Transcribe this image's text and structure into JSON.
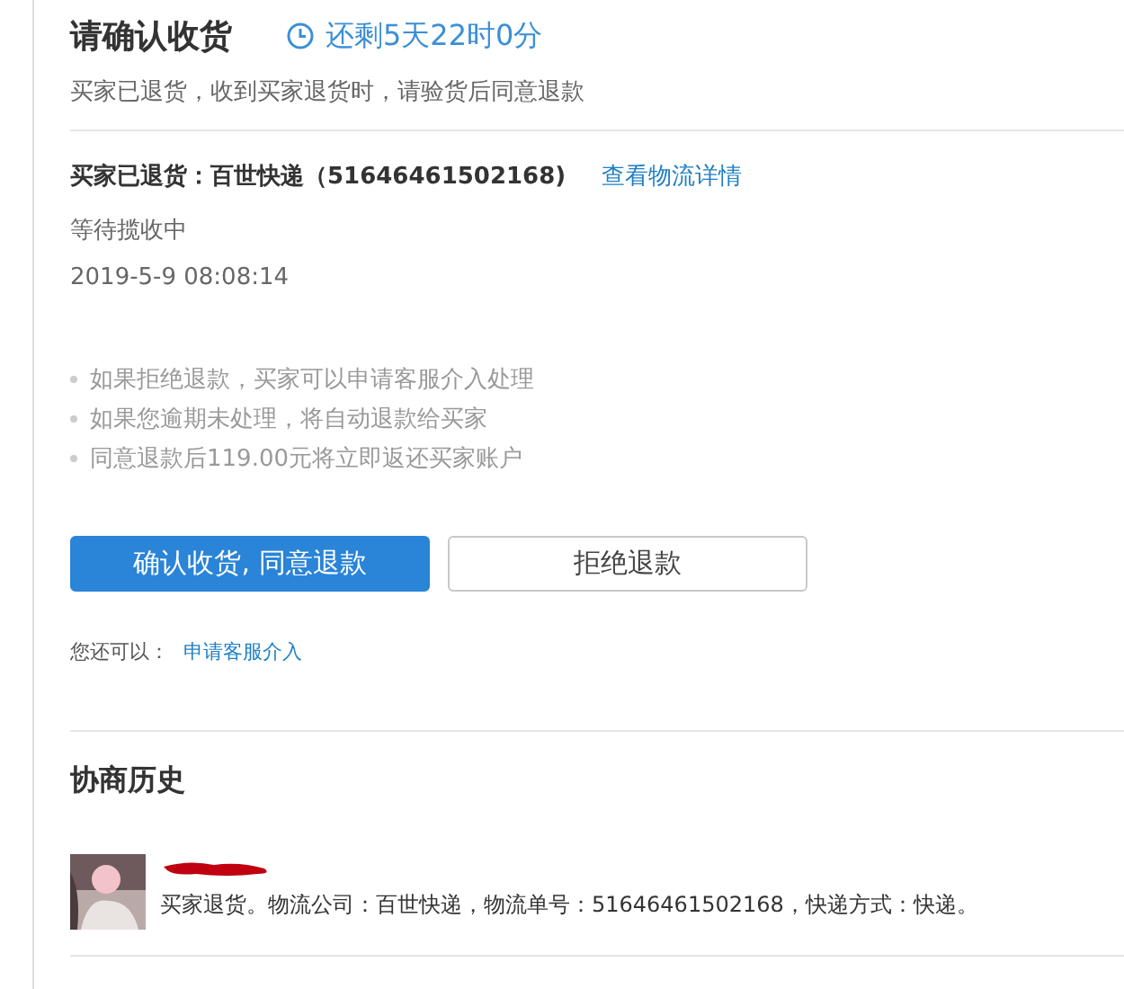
{
  "header": {
    "title": "请确认收货",
    "countdown": "还剩5天22时0分",
    "subtitle": "买家已退货，收到买家退货时，请验货后同意退款"
  },
  "shipment": {
    "label": "买家已退货：百世快递（51646461502168)",
    "link": "查看物流详情",
    "status": "等待揽收中",
    "time": "2019-5-9 08:08:14"
  },
  "notes": [
    "如果拒绝退款，买家可以申请客服介入处理",
    "如果您逾期未处理，将自动退款给买家",
    "同意退款后119.00元将立即返还买家账户"
  ],
  "buttons": [
    {
      "label": "确认收货, 同意退款",
      "kind": "primary"
    },
    {
      "label": "拒绝退款",
      "kind": "secondary"
    }
  ],
  "more": {
    "label": "您还可以：",
    "link": "申请客服介入"
  },
  "history": {
    "title": "协商历史",
    "entries": [
      {
        "message": "买家退货。物流公司：百世快递，物流单号：51646461502168，快递方式：快递。"
      }
    ]
  }
}
